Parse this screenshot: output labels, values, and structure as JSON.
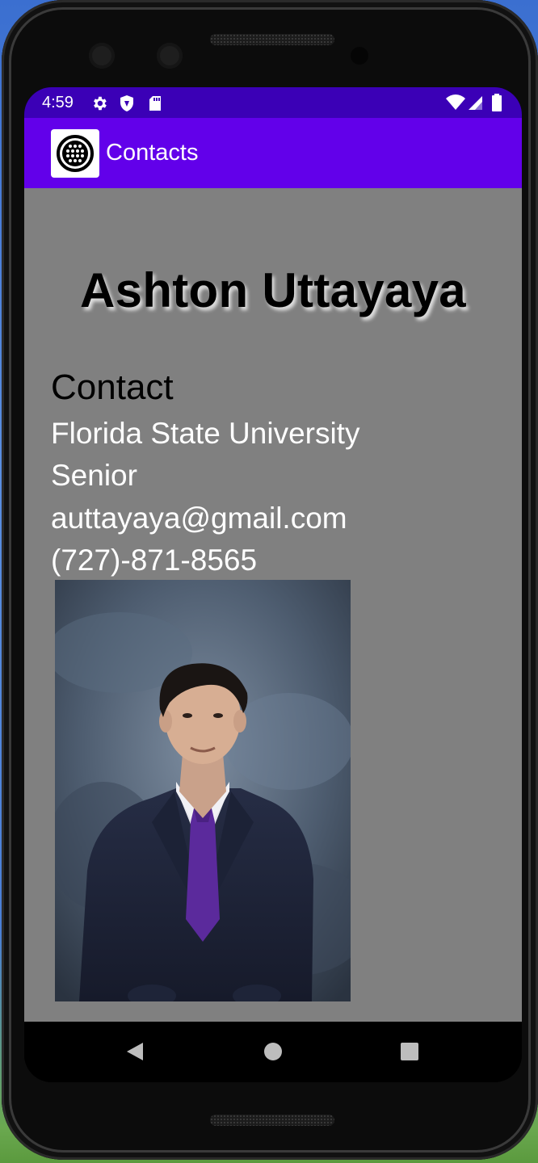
{
  "status_bar": {
    "time": "4:59",
    "icons": [
      "settings-icon",
      "shield-icon",
      "sd-card-icon",
      "wifi-icon",
      "signal-icon",
      "battery-icon"
    ]
  },
  "app_bar": {
    "title": "Contacts",
    "logo_icon": "contacts-logo-icon"
  },
  "profile": {
    "name": "Ashton Uttayaya",
    "section_heading": "Contact",
    "school": "Florida State University",
    "year": "Senior",
    "email": "auttayaya@gmail.com",
    "phone": "(727)-871-8565",
    "photo_alt": "Portrait of Ashton Uttayaya"
  },
  "nav_bar": {
    "icons": [
      "back-icon",
      "home-icon",
      "recents-icon"
    ]
  },
  "colors": {
    "status_bar": "#3b00b6",
    "app_bar": "#6200ea",
    "content_background": "#808080",
    "tie": "#5b2a9c"
  }
}
